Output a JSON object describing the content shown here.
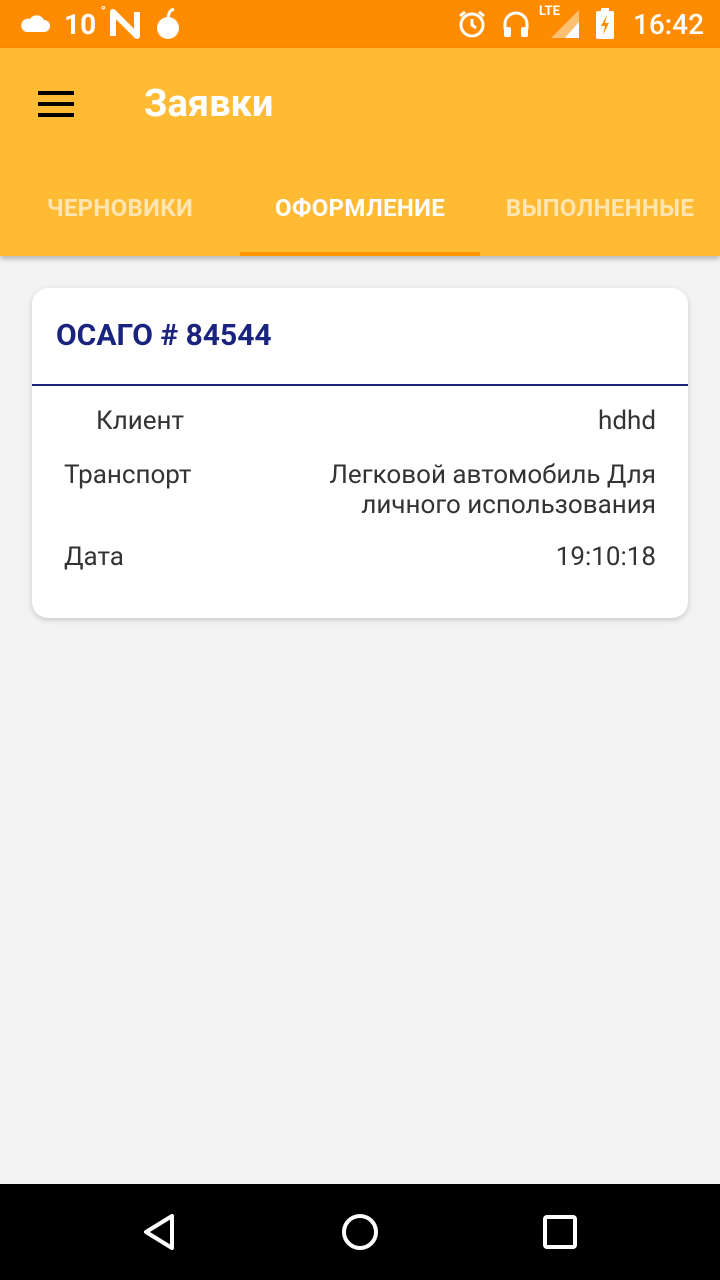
{
  "status_bar": {
    "temperature": "10",
    "degree_symbol": "°",
    "time": "16:42",
    "network_label": "LTE",
    "left_icons": [
      "cloud-icon",
      "n-icon",
      "bomb-icon"
    ],
    "right_icons": [
      "alarm-icon",
      "headphones-icon",
      "signal-icon",
      "battery-charging-icon"
    ]
  },
  "app_bar": {
    "title": "Заявки",
    "menu_icon": "hamburger-menu-icon",
    "background_color": "#ffbb33"
  },
  "tabs": [
    {
      "label": "ЧЕРНОВИКИ",
      "active": false
    },
    {
      "label": "ОФОРМЛЕНИЕ",
      "active": true
    },
    {
      "label": "ВЫПОЛНЕННЫЕ",
      "active": false
    }
  ],
  "card": {
    "title": "ОСАГО # 84544",
    "rows": [
      {
        "label": "Клиент",
        "value": "hdhd"
      },
      {
        "label": "Транспорт",
        "value_line1": "Легковой автомобиль Для",
        "value_line2": "личного использования"
      },
      {
        "label": "Дата",
        "value": "19:10:18"
      }
    ],
    "title_color": "#1a237e"
  },
  "nav_bar": {
    "buttons": [
      "back-icon",
      "home-icon",
      "recents-icon"
    ]
  },
  "colors": {
    "status_bar": "#ff8c00",
    "accent": "#ff9800",
    "background": "#f3f3f3"
  }
}
